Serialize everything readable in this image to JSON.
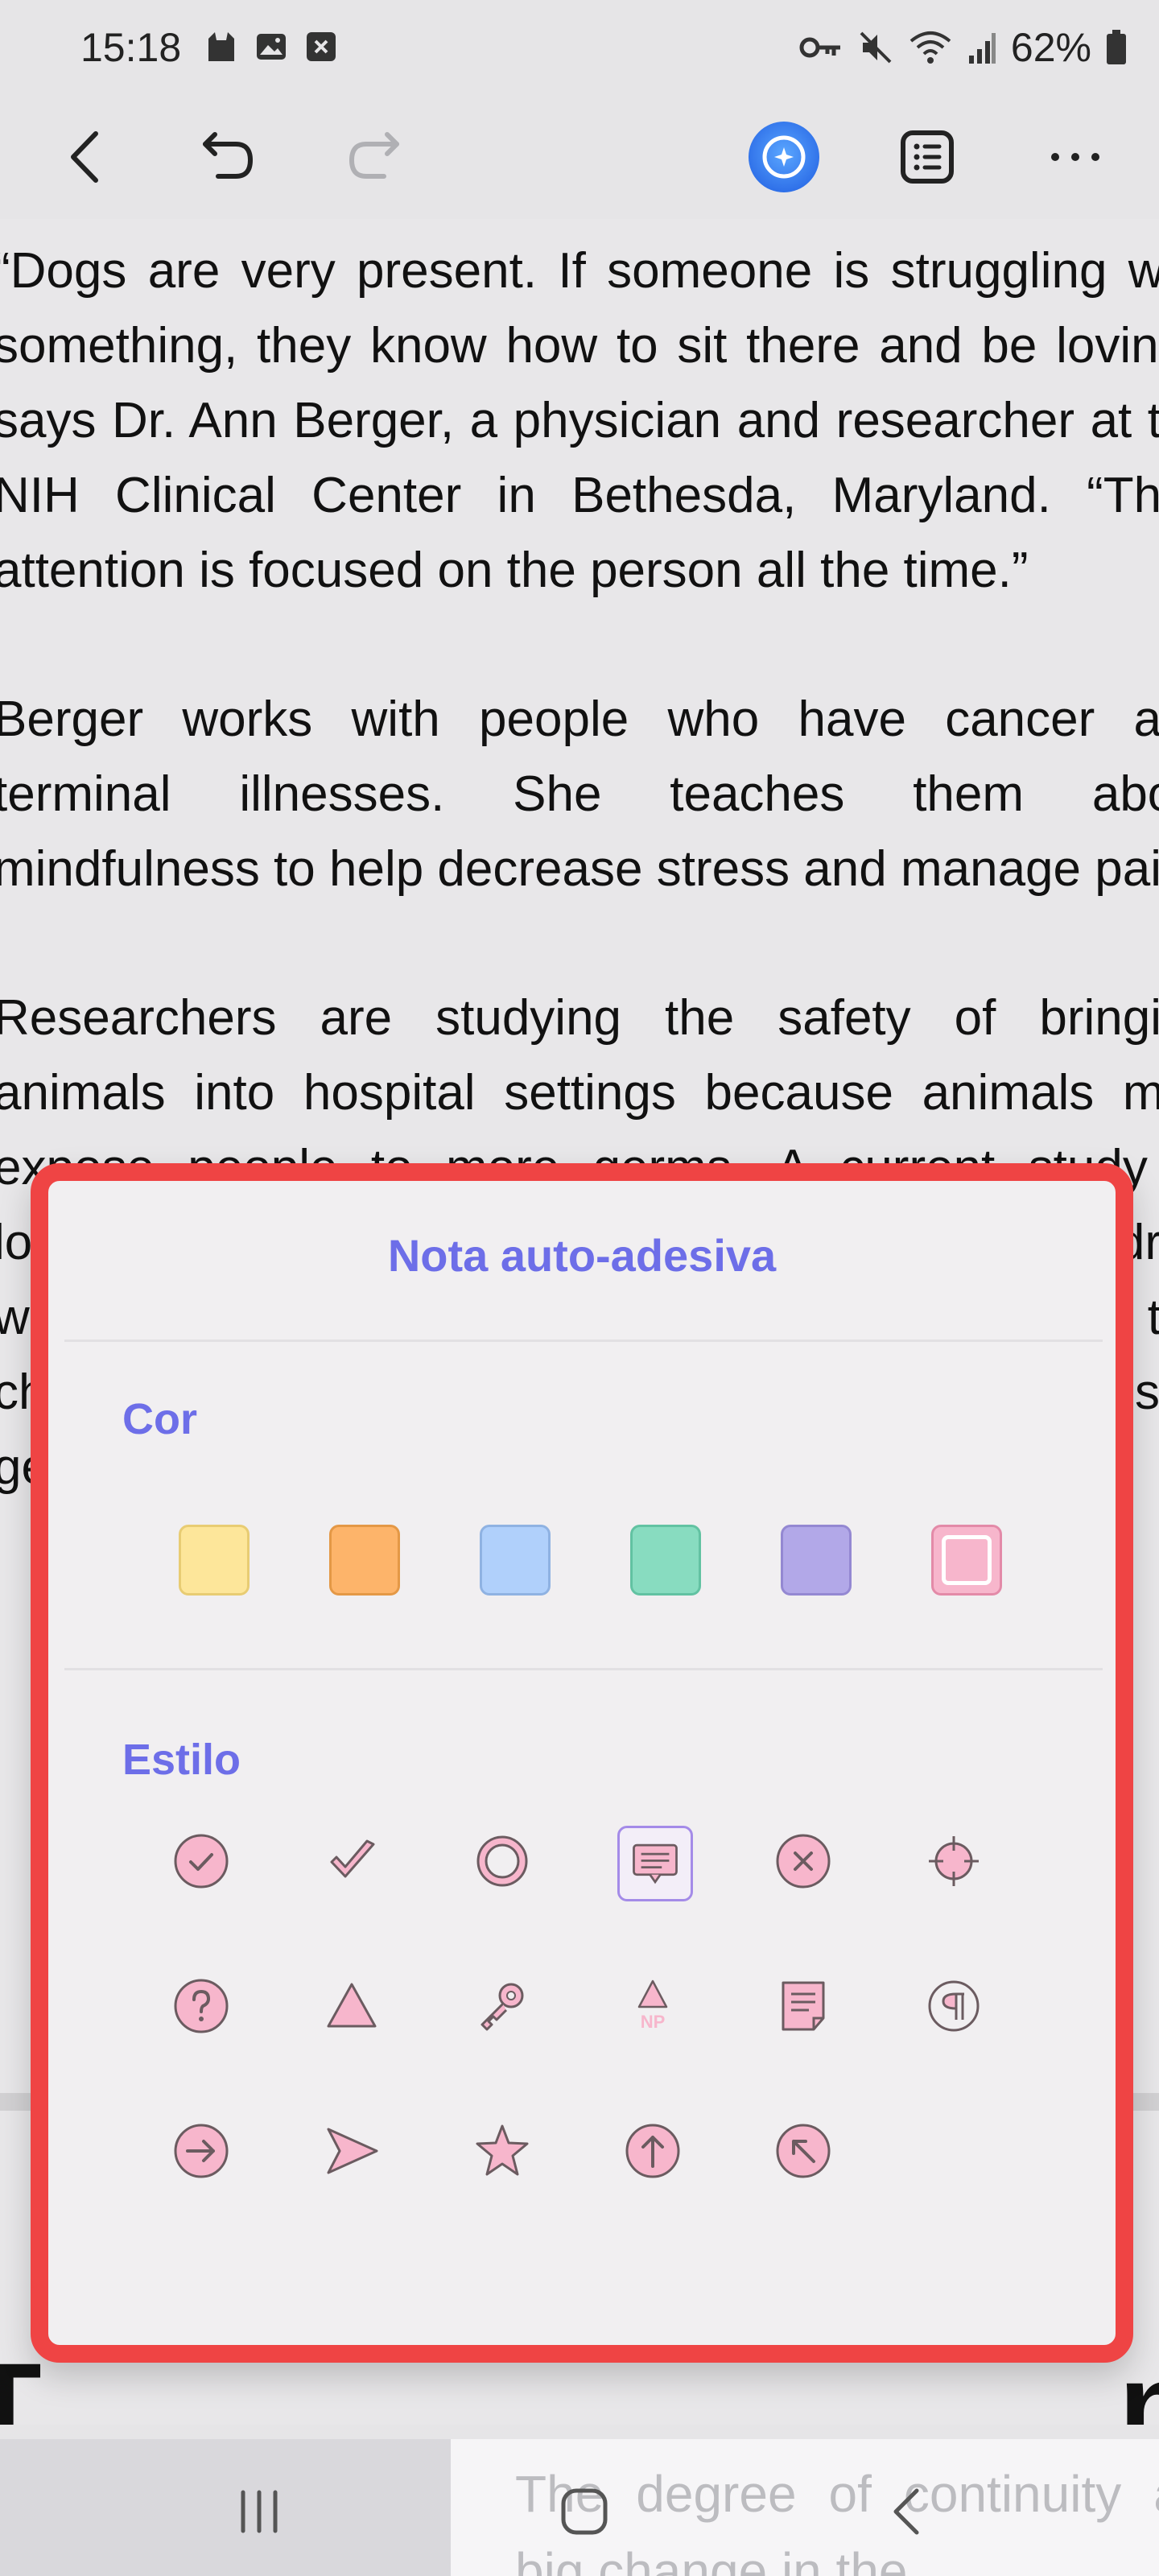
{
  "status": {
    "time": "15:18",
    "battery": "62%"
  },
  "toolbar": {
    "back": "back",
    "undo": "undo",
    "redo": "redo",
    "ai": "ai-assistant",
    "list": "table-of-contents",
    "more": "more-options"
  },
  "article": {
    "paragraphs": [
      "“Dogs are very present. If someone is struggling with something, they know how to sit there and be loving,” says Dr. Ann Berger, a physician and researcher at the NIH Clinical Center in Bethesda, Maryland. “Their attention is focused on the person all the time.”",
      "Berger works with people who have cancer and terminal illnesses. She teaches them about mindfulness to help decrease stress and manage pain.",
      "Researchers are studying the safety of bringing animals into hospital settings because animals may expose people to more germs. A current study is looking at the safety of bringing dogs to visit children with cancer, Esposito says. Scientists will be testing the children’s hands to see if there are dangerous levels of germs transferred from the dog after the visit."
    ],
    "bottom_partial": "The degree of continuity and big change in the"
  },
  "popup": {
    "title": "Nota auto-adesiva",
    "color_label": "Cor",
    "style_label": "Estilo",
    "colors": [
      {
        "name": "yellow",
        "fill": "#fde69a",
        "border": "#e8cc73",
        "selected": false
      },
      {
        "name": "orange",
        "fill": "#fdb46a",
        "border": "#e49846",
        "selected": false
      },
      {
        "name": "blue",
        "fill": "#b0d0fb",
        "border": "#8fb2e2",
        "selected": false
      },
      {
        "name": "green",
        "fill": "#88dcc0",
        "border": "#62c2a2",
        "selected": false
      },
      {
        "name": "purple",
        "fill": "#b2a8e8",
        "border": "#9488d2",
        "selected": false
      },
      {
        "name": "pink",
        "fill": "#f7b6cc",
        "border": "#e38aa8",
        "selected": true
      }
    ],
    "styles": [
      [
        "check-circle-icon",
        "check-icon",
        "circle-icon",
        "comment-icon",
        "x-circle-icon",
        "crosshair-icon"
      ],
      [
        "question-circle-icon",
        "triangle-icon",
        "key-icon",
        "np-triangle-icon",
        "note-icon",
        "paragraph-circle-icon"
      ],
      [
        "arrow-right-circle-icon",
        "send-arrow-icon",
        "star-icon",
        "arrow-up-circle-icon",
        "arrow-upleft-circle-icon"
      ]
    ],
    "selected_style": "comment-icon",
    "np_text": "NP",
    "accent": "#6d6ee8",
    "icon_fill": "#f7b6cc",
    "icon_stroke": "#6b5b60"
  }
}
